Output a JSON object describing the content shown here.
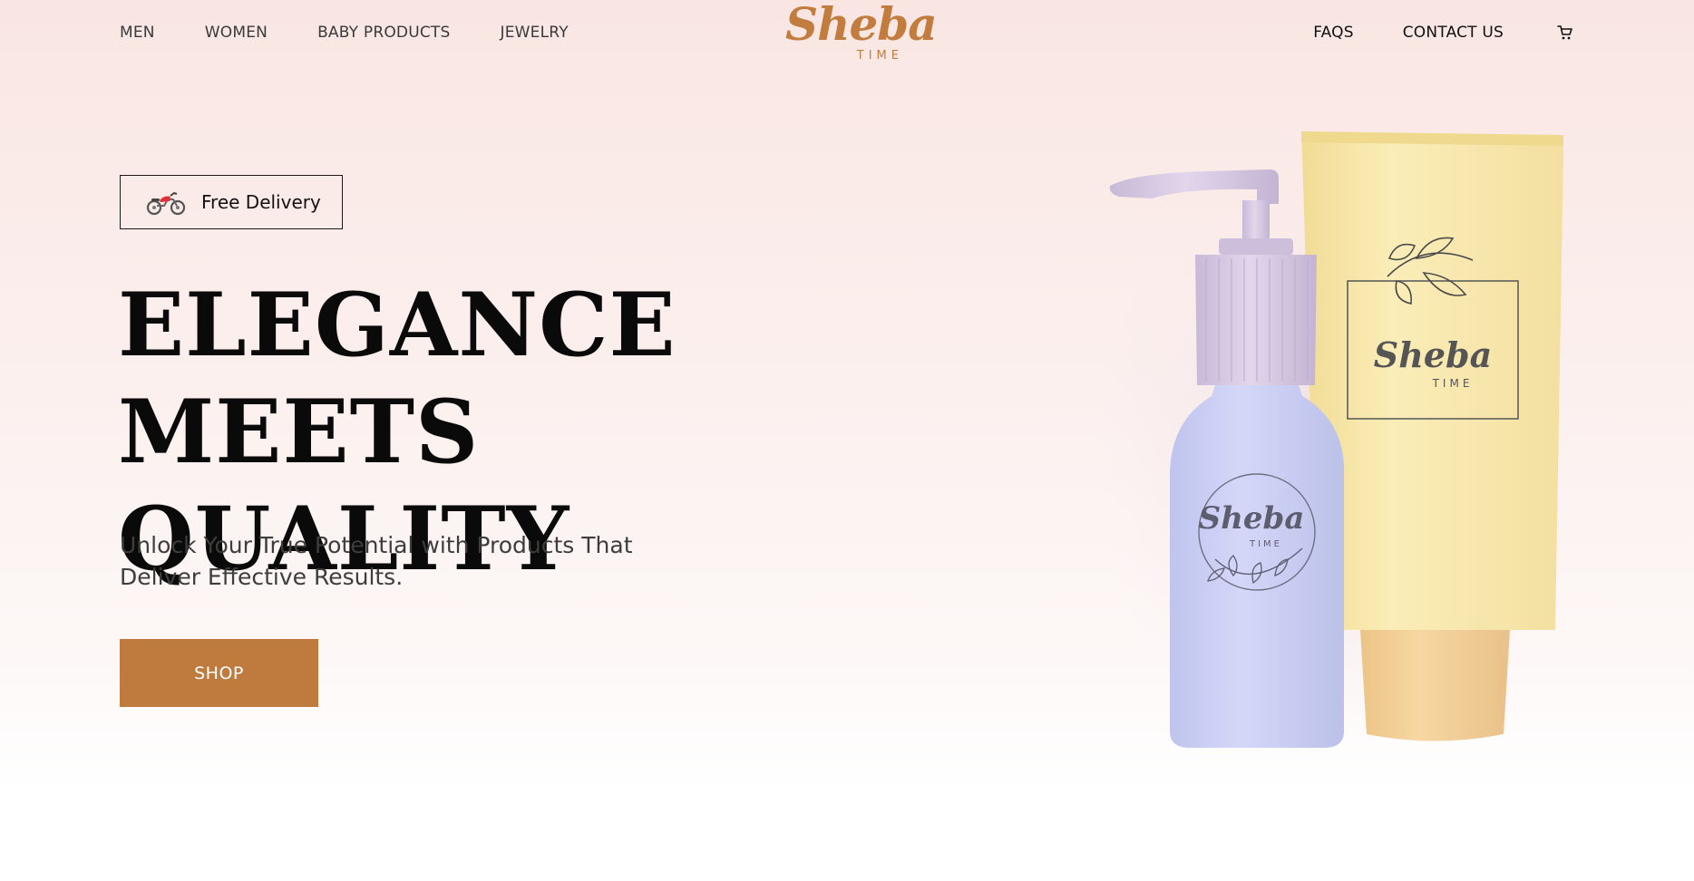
{
  "nav": {
    "left_items": [
      {
        "label": "MEN"
      },
      {
        "label": "WOMEN"
      },
      {
        "label": "BABY PRODUCTS"
      },
      {
        "label": "JEWELRY"
      }
    ],
    "right_items": [
      {
        "label": "FAQS"
      },
      {
        "label": "CONTACT US"
      }
    ],
    "cart_icon": "cart-icon"
  },
  "logo": {
    "main": "Sheba",
    "sub": "TIME"
  },
  "hero": {
    "badge": {
      "icon": "motorcycle-icon",
      "label": "Free Delivery"
    },
    "headline_line1": "ELEGANCE MEETS",
    "headline_line2": "QUALITY",
    "subtitle_line1": "Unlock Your True Potential with Products That",
    "subtitle_line2": "Deliver Effective Results.",
    "cta_label": "SHOP"
  },
  "product_image": {
    "bottle_brand": "Sheba",
    "bottle_sub": "TIME",
    "tube_brand": "Sheba",
    "tube_sub": "TIME"
  },
  "colors": {
    "accent": "#bf7a3e",
    "logo": "#c27d3e",
    "bottle": "#c9ccf2",
    "pump": "#d2c5e0",
    "tube": "#f6e6a8",
    "tube_cap": "#f2cf97"
  }
}
